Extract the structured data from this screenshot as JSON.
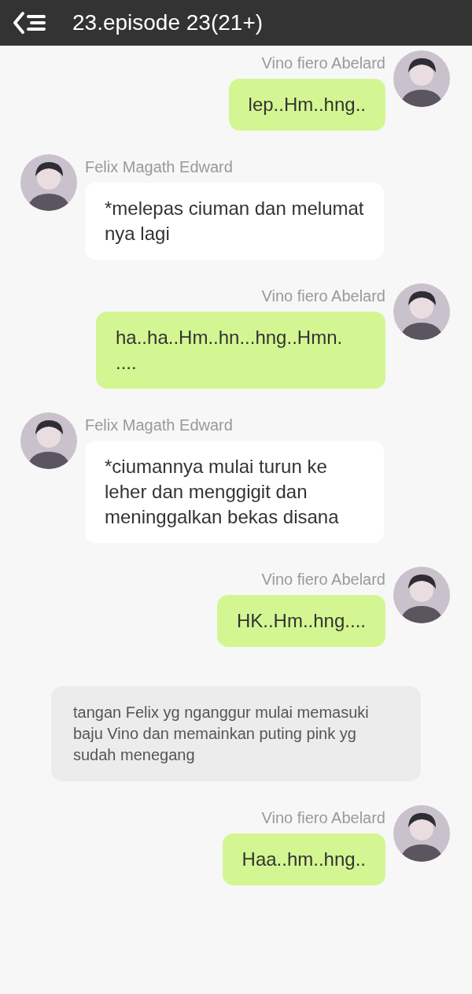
{
  "header": {
    "title": "23.episode 23(21+)"
  },
  "messages": [
    {
      "kind": "right",
      "sender": "Vino fiero Abelard",
      "text": "lep..Hm..hng.."
    },
    {
      "kind": "left",
      "sender": "Felix Magath Edward",
      "text": "*melepas ciuman dan melumat nya lagi"
    },
    {
      "kind": "right",
      "sender": "Vino fiero Abelard",
      "text": "ha..ha..Hm..hn...hng..Hmn. ...."
    },
    {
      "kind": "left",
      "sender": "Felix Magath Edward",
      "text": "*ciumannya mulai turun ke leher dan menggigit dan meninggalkan bekas disana"
    },
    {
      "kind": "right",
      "sender": "Vino fiero Abelard",
      "text": "HK..Hm..hng...."
    },
    {
      "kind": "narration",
      "text": "tangan Felix yg nganggur mulai memasuki baju Vino dan memainkan puting pink yg sudah menegang"
    },
    {
      "kind": "right",
      "sender": "Vino fiero Abelard",
      "text": "Haa..hm..hng.."
    }
  ]
}
